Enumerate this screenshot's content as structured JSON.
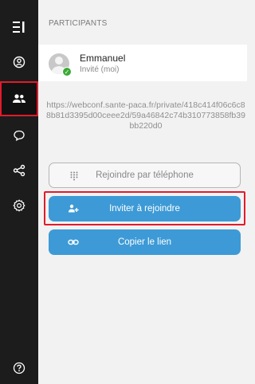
{
  "sidebar": {
    "items": [
      {
        "icon": "toggle-panel-icon"
      },
      {
        "icon": "user-circle-icon"
      },
      {
        "icon": "participants-icon",
        "selected": true
      },
      {
        "icon": "chat-icon"
      },
      {
        "icon": "share-icon"
      },
      {
        "icon": "settings-icon"
      },
      {
        "icon": "help-icon"
      }
    ]
  },
  "participants": {
    "section_title": "PARTICIPANTS",
    "list": [
      {
        "name": "Emmanuel",
        "role": "Invité (moi)"
      }
    ]
  },
  "invite": {
    "link": "https://webconf.sante-paca.fr/private/418c414f06c6c88b81d3395d00ceee2d/59a46842c74b310773858fb39bb220d0",
    "phone_button": "Rejoindre par téléphone",
    "invite_button": "Inviter à rejoindre",
    "copy_button": "Copier le lien"
  },
  "colors": {
    "sidebar_bg": "#1c1c1c",
    "accent": "#3d9ad6",
    "highlight": "#e01b2c",
    "status_ok": "#3aaa35"
  }
}
